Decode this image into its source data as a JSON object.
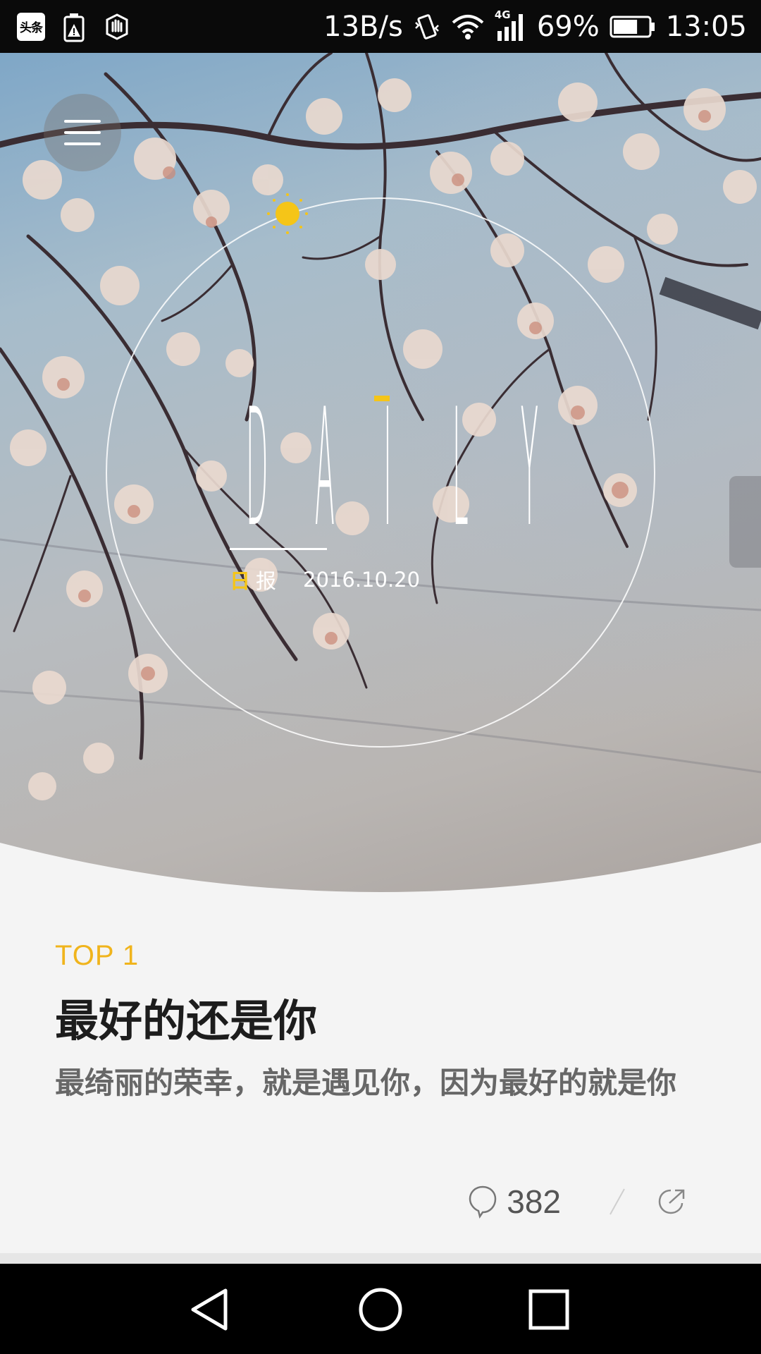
{
  "status_bar": {
    "app_badge": "头条",
    "net_speed": "13B/s",
    "network_type": "4G",
    "battery_percent": "69%",
    "battery_level": 0.69,
    "time": "13:05"
  },
  "hero": {
    "logo_letters": [
      "D",
      "A",
      "I",
      "L",
      "Y"
    ],
    "caption_day": "日",
    "caption_bao": "报",
    "date": "2016.10.20",
    "accent_color": "#f5c518"
  },
  "article": {
    "rank": "TOP 1",
    "title": "最好的还是你",
    "summary": "最绮丽的荣幸，就是遇见你，因为最好的就是你",
    "comment_count": "382"
  },
  "colors": {
    "accent": "#f5c518",
    "rank_color": "#f0b41c",
    "card_background": "#f4f4f4"
  },
  "icons": {
    "menu": "menu-icon",
    "sun": "sun-icon",
    "comment": "comment-icon",
    "share": "share-icon",
    "back": "back-icon",
    "home": "home-icon",
    "recents": "recents-icon"
  }
}
